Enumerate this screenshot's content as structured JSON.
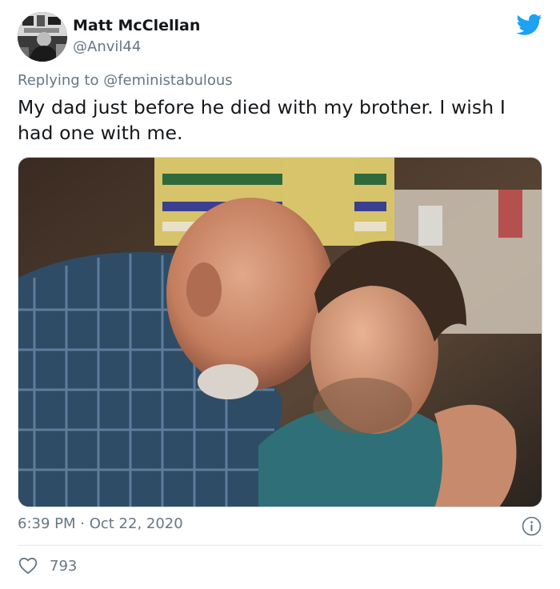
{
  "author": {
    "display_name": "Matt McClellan",
    "handle": "@Anvil44",
    "avatar_icon": "profile-photo"
  },
  "brand": {
    "icon": "twitter-bird-icon",
    "color": "#1da1f2"
  },
  "reply": {
    "prefix": "Replying to ",
    "mention": "@feministabulous"
  },
  "tweet": {
    "text": "My dad just before he died with my brother. I wish I had one with me."
  },
  "media": {
    "alt": "photo"
  },
  "meta": {
    "time": "6:39 PM",
    "separator": " · ",
    "date": "Oct 22, 2020",
    "info_icon": "info-icon"
  },
  "engagement": {
    "likes": "793",
    "like_icon": "heart-icon"
  },
  "colors": {
    "text": "#14171a",
    "secondary": "#657786",
    "divider": "#e1e8ed"
  }
}
